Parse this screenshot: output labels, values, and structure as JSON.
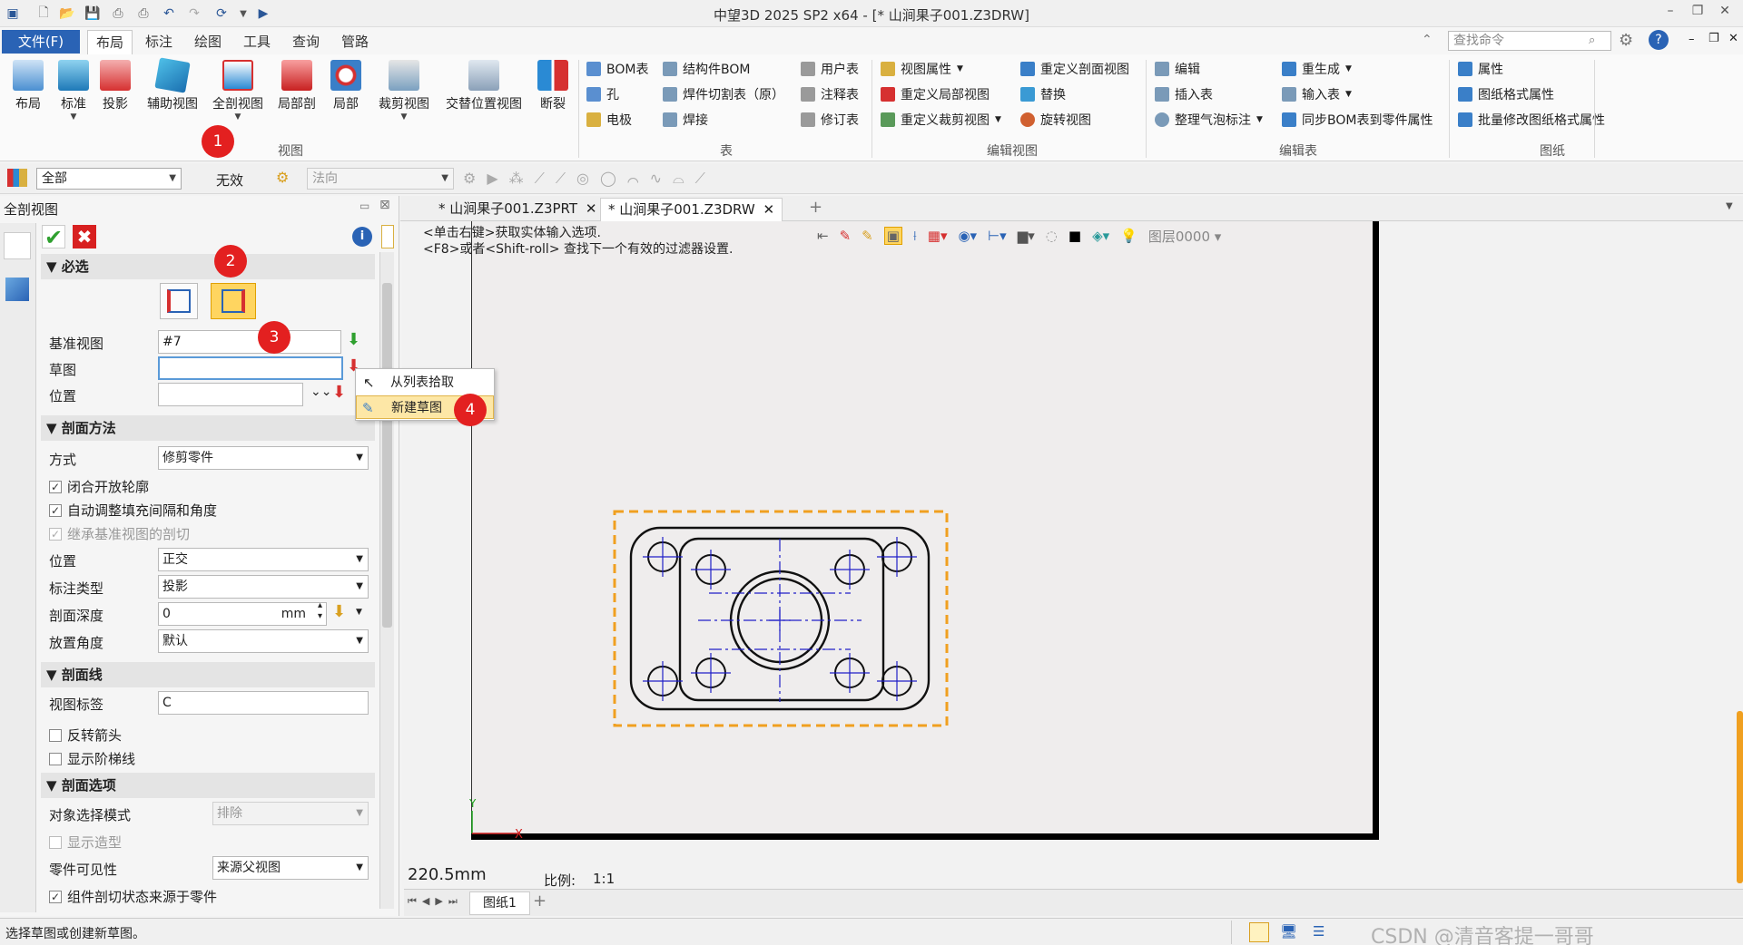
{
  "titlebar": {
    "title": "中望3D 2025 SP2 x64 - [* 山涧果子001.Z3DRW]"
  },
  "menubar": {
    "file_label": "文件(F)",
    "tabs": [
      "布局",
      "标注",
      "绘图",
      "工具",
      "查询",
      "管路"
    ],
    "active_tab": "布局",
    "search_placeholder": "查找命令"
  },
  "ribbon": {
    "view_group": {
      "buttons": [
        "布局",
        "标准",
        "投影",
        "辅助视图",
        "全剖视图",
        "局部剖",
        "局部",
        "裁剪视图",
        "交替位置视图",
        "断裂"
      ],
      "label": "视图"
    },
    "table_group": {
      "items": [
        "BOM表",
        "孔",
        "电极",
        "结构件BOM",
        "焊件切割表（原）",
        "焊接",
        "用户表",
        "注释表",
        "修订表"
      ],
      "label": "表"
    },
    "edit_view_group": {
      "items": [
        "视图属性",
        "重定义局部视图",
        "重定义裁剪视图",
        "重定义剖面视图",
        "替换",
        "旋转视图"
      ],
      "label": "编辑视图"
    },
    "edit_table_group": {
      "items": [
        "编辑",
        "插入表",
        "整理气泡标注",
        "重生成",
        "输入表",
        "同步BOM表到零件属性"
      ],
      "label": "编辑表"
    },
    "sheet_group": {
      "items": [
        "属性",
        "图纸格式属性",
        "批量修改图纸格式属性"
      ],
      "label": "图纸"
    }
  },
  "filterbar": {
    "filter_value": "全部",
    "invalid_label": "无效",
    "direction_placeholder": "法向"
  },
  "panel": {
    "title": "全剖视图",
    "required_header": "必选",
    "base_view_label": "基准视图",
    "base_view_value": "#7",
    "sketch_label": "草图",
    "sketch_value": "",
    "position_label": "位置",
    "position_value": "",
    "method_header": "剖面方法",
    "mode_label": "方式",
    "mode_value": "修剪零件",
    "chk_close_open": "闭合开放轮廓",
    "chk_auto_adjust": "自动调整填充间隔和角度",
    "chk_inherit": "继承基准视图的剖切",
    "pos2_label": "位置",
    "pos2_value": "正交",
    "dim_type_label": "标注类型",
    "dim_type_value": "投影",
    "depth_label": "剖面深度",
    "depth_value": "0",
    "depth_unit": "mm",
    "angle_label": "放置角度",
    "angle_value": "默认",
    "section_line_header": "剖面线",
    "view_label_label": "视图标签",
    "view_label_value": "C",
    "chk_reverse_arrow": "反转箭头",
    "chk_show_step": "显示阶梯线",
    "options_header": "剖面选项",
    "obj_mode_label": "对象选择模式",
    "obj_mode_value": "排除",
    "chk_show_shape": "显示造型",
    "part_vis_label": "零件可见性",
    "part_vis_value": "来源父视图",
    "chk_component_state": "组件剖切状态来源于零件"
  },
  "popup": {
    "item1": "从列表拾取",
    "item2": "新建草图"
  },
  "doctabs": {
    "tab1": "* 山涧果子001.Z3PRT",
    "tab2": "* 山涧果子001.Z3DRW"
  },
  "canvas": {
    "hint_line1": "<单击右键>获取实体输入选项.",
    "hint_line2": "<F8>或者<Shift-roll> 查找下一个有效的过滤器设置.",
    "layer": "图层0000",
    "size_readout": "220.5mm",
    "scale_label": "比例:",
    "scale_value": "1:1",
    "sheet_tab": "图纸1"
  },
  "status": {
    "message": "选择草图或创建新草图。",
    "watermark": "CSDN @清音客提一哥哥"
  },
  "badges": [
    "1",
    "2",
    "3",
    "4"
  ],
  "colors": {
    "accent": "#2a63b5",
    "badge": "#e32020",
    "selection_orange": "#f0a020",
    "centerline_blue": "#2020c8"
  }
}
